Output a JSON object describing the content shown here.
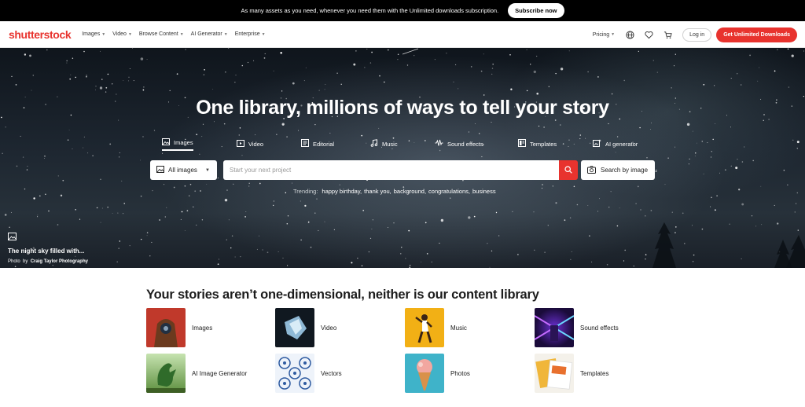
{
  "promo": {
    "text": "As many assets as you need, whenever you need them with the Unlimited downloads subscription.",
    "button": "Subscribe now"
  },
  "nav": {
    "logo": "shutterstock",
    "menu": [
      {
        "label": "Images"
      },
      {
        "label": "Video"
      },
      {
        "label": "Browse Content"
      },
      {
        "label": "AI Generator"
      },
      {
        "label": "Enterprise"
      }
    ],
    "pricing": "Pricing",
    "login": "Log in",
    "cta": "Get Unlimited Downloads",
    "icons": [
      "globe-icon",
      "heart-icon",
      "cart-icon"
    ]
  },
  "hero": {
    "title": "One library, millions of ways to tell your story",
    "tabs": [
      {
        "label": "Images",
        "icon": "image-icon",
        "active": true
      },
      {
        "label": "Video",
        "icon": "video-icon"
      },
      {
        "label": "Editorial",
        "icon": "editorial-icon"
      },
      {
        "label": "Music",
        "icon": "music-icon"
      },
      {
        "label": "Sound effects",
        "icon": "sound-wave-icon"
      },
      {
        "label": "Templates",
        "icon": "templates-icon"
      },
      {
        "label": "AI generator",
        "icon": "ai-generator-icon"
      }
    ],
    "search": {
      "type": "All images",
      "placeholder": "Start your next project",
      "image_search": "Search by image"
    },
    "trending": {
      "label": "Trending:",
      "items": [
        "happy birthday,",
        "thank you,",
        "background,",
        "congratulations,",
        "business"
      ]
    },
    "credit": {
      "title": "The night sky filled with...",
      "prefix": "Photo",
      "by": "by",
      "author": "Craig Taylor Photography"
    }
  },
  "library": {
    "title": "Your stories aren’t one-dimensional, neither is our content library",
    "items": [
      {
        "label": "Images"
      },
      {
        "label": "Video"
      },
      {
        "label": "Music"
      },
      {
        "label": "Sound effects"
      },
      {
        "label": "AI Image Generator"
      },
      {
        "label": "Vectors"
      },
      {
        "label": "Photos"
      },
      {
        "label": "Templates"
      }
    ]
  },
  "colors": {
    "brand": "#e8332e",
    "promo_bg": "#000000",
    "hero_sky": "#1d2630"
  }
}
